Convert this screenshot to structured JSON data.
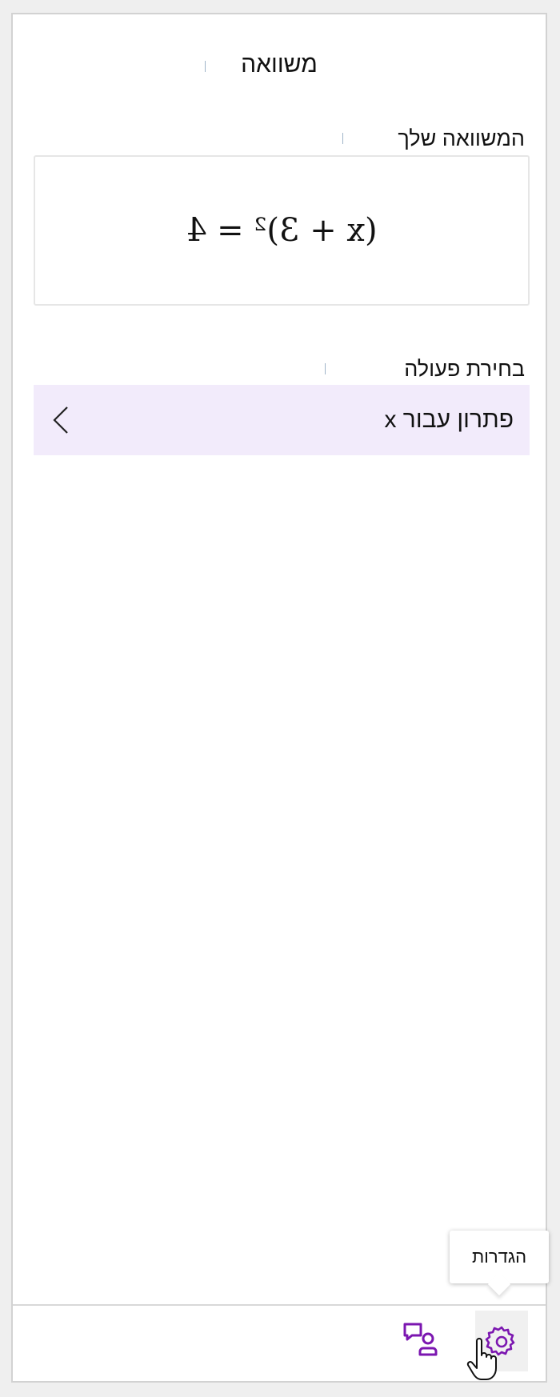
{
  "pane": {
    "title": "משוואה"
  },
  "equation_section": {
    "label": "המשוואה שלך",
    "equation": "(x + 3)² = 4"
  },
  "action_section": {
    "label": "בחירת פעולה",
    "items": [
      {
        "label": "פתרון עבור x",
        "icon": "chevron-left-icon"
      }
    ]
  },
  "bottom_bar": {
    "buttons": [
      {
        "name": "settings",
        "icon": "gear-icon"
      },
      {
        "name": "feedback",
        "icon": "chat-person-icon"
      }
    ],
    "tooltip": "הגדרות"
  },
  "colors": {
    "accent": "#7b16b0",
    "action_item_bg": "#f2ebfb",
    "frame_border": "#d2d2d2",
    "page_bg": "#efefef"
  }
}
